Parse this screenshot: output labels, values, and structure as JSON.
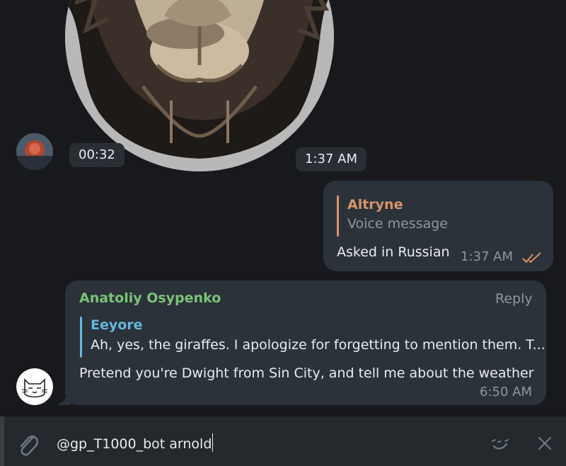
{
  "video_message": {
    "duration": "00:32",
    "time": "1:37 AM"
  },
  "outgoing_message": {
    "reply_to": {
      "name": "Altryne",
      "text": "Voice message"
    },
    "text": "Asked in Russian",
    "time": "1:37 AM",
    "status_icon": "double-check-icon"
  },
  "incoming_message": {
    "sender": "Anatoliy Osypenko",
    "reply_action": "Reply",
    "reply_to": {
      "name": "Eeyore",
      "text": "Ah, yes, the giraffes. I apologize for forgetting to mention them. T..."
    },
    "text": "Pretend you're Dwight from Sin City, and tell me about the weather",
    "time": "6:50 AM"
  },
  "composer": {
    "value": "@gp_T1000_bot arnold",
    "attach_icon": "paperclip-icon",
    "bot_commands_icon": "bot-commands-icon",
    "clear_icon": "close-icon"
  },
  "colors": {
    "background": "#17191d",
    "bubble": "#2b323a",
    "altryne_name": "#d9956a",
    "anatoliy_name": "#7cc276",
    "eeyore_name": "#63b7db",
    "read_check": "#d9956a",
    "composer": "#24292e"
  }
}
